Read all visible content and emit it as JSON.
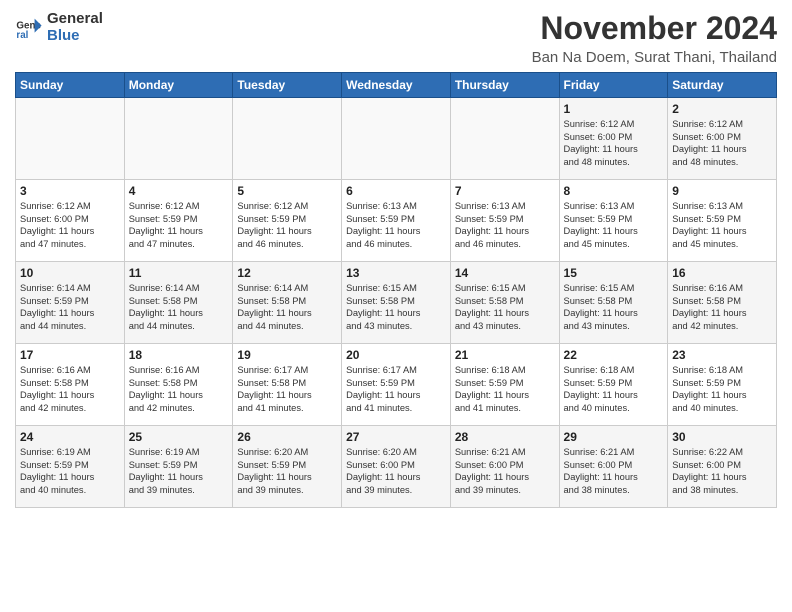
{
  "logo": {
    "line1": "General",
    "line2": "Blue"
  },
  "header": {
    "month": "November 2024",
    "location": "Ban Na Doem, Surat Thani, Thailand"
  },
  "weekdays": [
    "Sunday",
    "Monday",
    "Tuesday",
    "Wednesday",
    "Thursday",
    "Friday",
    "Saturday"
  ],
  "weeks": [
    [
      {
        "day": "",
        "info": ""
      },
      {
        "day": "",
        "info": ""
      },
      {
        "day": "",
        "info": ""
      },
      {
        "day": "",
        "info": ""
      },
      {
        "day": "",
        "info": ""
      },
      {
        "day": "1",
        "info": "Sunrise: 6:12 AM\nSunset: 6:00 PM\nDaylight: 11 hours\nand 48 minutes."
      },
      {
        "day": "2",
        "info": "Sunrise: 6:12 AM\nSunset: 6:00 PM\nDaylight: 11 hours\nand 48 minutes."
      }
    ],
    [
      {
        "day": "3",
        "info": "Sunrise: 6:12 AM\nSunset: 6:00 PM\nDaylight: 11 hours\nand 47 minutes."
      },
      {
        "day": "4",
        "info": "Sunrise: 6:12 AM\nSunset: 5:59 PM\nDaylight: 11 hours\nand 47 minutes."
      },
      {
        "day": "5",
        "info": "Sunrise: 6:12 AM\nSunset: 5:59 PM\nDaylight: 11 hours\nand 46 minutes."
      },
      {
        "day": "6",
        "info": "Sunrise: 6:13 AM\nSunset: 5:59 PM\nDaylight: 11 hours\nand 46 minutes."
      },
      {
        "day": "7",
        "info": "Sunrise: 6:13 AM\nSunset: 5:59 PM\nDaylight: 11 hours\nand 46 minutes."
      },
      {
        "day": "8",
        "info": "Sunrise: 6:13 AM\nSunset: 5:59 PM\nDaylight: 11 hours\nand 45 minutes."
      },
      {
        "day": "9",
        "info": "Sunrise: 6:13 AM\nSunset: 5:59 PM\nDaylight: 11 hours\nand 45 minutes."
      }
    ],
    [
      {
        "day": "10",
        "info": "Sunrise: 6:14 AM\nSunset: 5:59 PM\nDaylight: 11 hours\nand 44 minutes."
      },
      {
        "day": "11",
        "info": "Sunrise: 6:14 AM\nSunset: 5:58 PM\nDaylight: 11 hours\nand 44 minutes."
      },
      {
        "day": "12",
        "info": "Sunrise: 6:14 AM\nSunset: 5:58 PM\nDaylight: 11 hours\nand 44 minutes."
      },
      {
        "day": "13",
        "info": "Sunrise: 6:15 AM\nSunset: 5:58 PM\nDaylight: 11 hours\nand 43 minutes."
      },
      {
        "day": "14",
        "info": "Sunrise: 6:15 AM\nSunset: 5:58 PM\nDaylight: 11 hours\nand 43 minutes."
      },
      {
        "day": "15",
        "info": "Sunrise: 6:15 AM\nSunset: 5:58 PM\nDaylight: 11 hours\nand 43 minutes."
      },
      {
        "day": "16",
        "info": "Sunrise: 6:16 AM\nSunset: 5:58 PM\nDaylight: 11 hours\nand 42 minutes."
      }
    ],
    [
      {
        "day": "17",
        "info": "Sunrise: 6:16 AM\nSunset: 5:58 PM\nDaylight: 11 hours\nand 42 minutes."
      },
      {
        "day": "18",
        "info": "Sunrise: 6:16 AM\nSunset: 5:58 PM\nDaylight: 11 hours\nand 42 minutes."
      },
      {
        "day": "19",
        "info": "Sunrise: 6:17 AM\nSunset: 5:58 PM\nDaylight: 11 hours\nand 41 minutes."
      },
      {
        "day": "20",
        "info": "Sunrise: 6:17 AM\nSunset: 5:59 PM\nDaylight: 11 hours\nand 41 minutes."
      },
      {
        "day": "21",
        "info": "Sunrise: 6:18 AM\nSunset: 5:59 PM\nDaylight: 11 hours\nand 41 minutes."
      },
      {
        "day": "22",
        "info": "Sunrise: 6:18 AM\nSunset: 5:59 PM\nDaylight: 11 hours\nand 40 minutes."
      },
      {
        "day": "23",
        "info": "Sunrise: 6:18 AM\nSunset: 5:59 PM\nDaylight: 11 hours\nand 40 minutes."
      }
    ],
    [
      {
        "day": "24",
        "info": "Sunrise: 6:19 AM\nSunset: 5:59 PM\nDaylight: 11 hours\nand 40 minutes."
      },
      {
        "day": "25",
        "info": "Sunrise: 6:19 AM\nSunset: 5:59 PM\nDaylight: 11 hours\nand 39 minutes."
      },
      {
        "day": "26",
        "info": "Sunrise: 6:20 AM\nSunset: 5:59 PM\nDaylight: 11 hours\nand 39 minutes."
      },
      {
        "day": "27",
        "info": "Sunrise: 6:20 AM\nSunset: 6:00 PM\nDaylight: 11 hours\nand 39 minutes."
      },
      {
        "day": "28",
        "info": "Sunrise: 6:21 AM\nSunset: 6:00 PM\nDaylight: 11 hours\nand 39 minutes."
      },
      {
        "day": "29",
        "info": "Sunrise: 6:21 AM\nSunset: 6:00 PM\nDaylight: 11 hours\nand 38 minutes."
      },
      {
        "day": "30",
        "info": "Sunrise: 6:22 AM\nSunset: 6:00 PM\nDaylight: 11 hours\nand 38 minutes."
      }
    ]
  ]
}
